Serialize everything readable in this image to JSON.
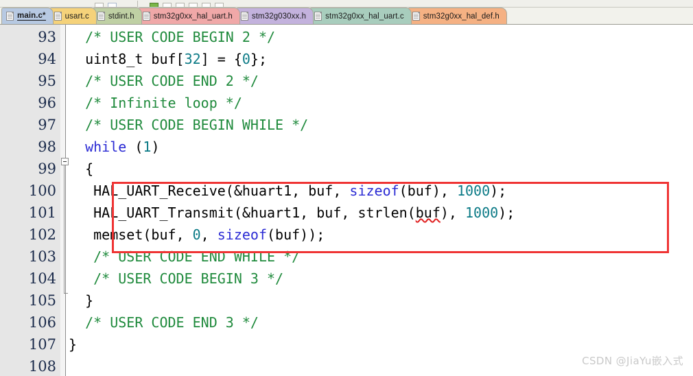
{
  "toolbar": {
    "label": "toolbar-strip"
  },
  "tabbar": {
    "tabs": [
      {
        "label": "main.c*",
        "color": "#b7c9e2",
        "active": true
      },
      {
        "label": "usart.c",
        "color": "#f5d27a",
        "active": false
      },
      {
        "label": "stdint.h",
        "color": "#bfd0a4",
        "active": false
      },
      {
        "label": "stm32g0xx_hal_uart.h",
        "color": "#f0a8a8",
        "active": false
      },
      {
        "label": "stm32g030xx.h",
        "color": "#c3b2dd",
        "active": false
      },
      {
        "label": "stm32g0xx_hal_uart.c",
        "color": "#a8cdbd",
        "active": false
      },
      {
        "label": "stm32g0xx_hal_def.h",
        "color": "#f5b183",
        "active": false
      }
    ]
  },
  "editor": {
    "first_line": 93,
    "gutter_background": "#e6e6e6",
    "highlight_color": "#ef3434",
    "lines": [
      {
        "number": "93",
        "indent": 2,
        "tokens": [
          {
            "t": "/* USER CODE BEGIN 2 */",
            "c": "cmt"
          }
        ]
      },
      {
        "number": "94",
        "indent": 2,
        "tokens": [
          {
            "t": "uint8_t buf[",
            "c": "fn"
          },
          {
            "t": "32",
            "c": "num"
          },
          {
            "t": "] = {",
            "c": "fn"
          },
          {
            "t": "0",
            "c": "num"
          },
          {
            "t": "};",
            "c": "fn"
          }
        ]
      },
      {
        "number": "95",
        "indent": 2,
        "tokens": [
          {
            "t": "/* USER CODE END 2 */",
            "c": "cmt"
          }
        ]
      },
      {
        "number": "96",
        "indent": 2,
        "tokens": [
          {
            "t": "/* Infinite loop */",
            "c": "cmt"
          }
        ]
      },
      {
        "number": "97",
        "indent": 2,
        "tokens": [
          {
            "t": "/* USER CODE BEGIN WHILE */",
            "c": "cmt"
          }
        ]
      },
      {
        "number": "98",
        "indent": 2,
        "tokens": [
          {
            "t": "while",
            "c": "kw"
          },
          {
            "t": " (",
            "c": "fn"
          },
          {
            "t": "1",
            "c": "num"
          },
          {
            "t": ")",
            "c": "fn"
          }
        ]
      },
      {
        "number": "99",
        "indent": 2,
        "tokens": [
          {
            "t": "{",
            "c": "fn"
          }
        ]
      },
      {
        "number": "100",
        "indent": 3,
        "tokens": [
          {
            "t": "HAL_UART_Receive(&huart1, buf, ",
            "c": "fn"
          },
          {
            "t": "sizeof",
            "c": "kw"
          },
          {
            "t": "(buf), ",
            "c": "fn"
          },
          {
            "t": "1000",
            "c": "num"
          },
          {
            "t": ");",
            "c": "fn"
          }
        ]
      },
      {
        "number": "101",
        "indent": 3,
        "tokens": [
          {
            "t": "HAL_UART_Transmit(&huart1, buf, strlen(",
            "c": "fn"
          },
          {
            "t": "buf",
            "c": "sq"
          },
          {
            "t": "), ",
            "c": "fn"
          },
          {
            "t": "1000",
            "c": "num"
          },
          {
            "t": ");",
            "c": "fn"
          }
        ]
      },
      {
        "number": "102",
        "indent": 3,
        "tokens": [
          {
            "t": "memset(buf, ",
            "c": "fn"
          },
          {
            "t": "0",
            "c": "num"
          },
          {
            "t": ", ",
            "c": "fn"
          },
          {
            "t": "sizeof",
            "c": "kw"
          },
          {
            "t": "(buf));",
            "c": "fn"
          }
        ]
      },
      {
        "number": "103",
        "indent": 3,
        "tokens": [
          {
            "t": "/* USER CODE END WHILE */",
            "c": "cmt"
          }
        ]
      },
      {
        "number": "104",
        "indent": 3,
        "tokens": [
          {
            "t": "/* USER CODE BEGIN 3 */",
            "c": "cmt"
          }
        ]
      },
      {
        "number": "105",
        "indent": 2,
        "tokens": [
          {
            "t": "}",
            "c": "fn"
          }
        ]
      },
      {
        "number": "106",
        "indent": 2,
        "tokens": [
          {
            "t": "/* USER CODE END 3 */",
            "c": "cmt"
          }
        ]
      },
      {
        "number": "107",
        "indent": 0,
        "tokens": [
          {
            "t": "}",
            "c": "fn"
          }
        ]
      },
      {
        "number": "108",
        "indent": 0,
        "tokens": []
      }
    ]
  },
  "watermark": {
    "text": "CSDN @JiaYu嵌入式"
  }
}
